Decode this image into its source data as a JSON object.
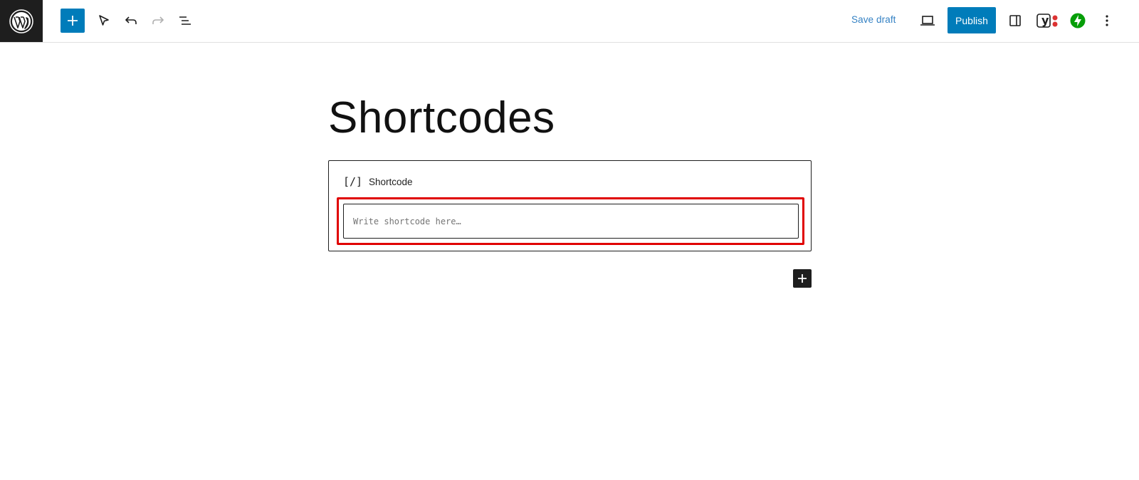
{
  "toolbar": {
    "logo_icon": "wordpress-logo-icon",
    "add_block_icon": "plus-icon",
    "tools_icon": "select-pointer-icon",
    "undo_icon": "undo-icon",
    "redo_icon": "redo-icon",
    "document_overview_icon": "list-view-icon",
    "save_draft_label": "Save draft",
    "preview_icon": "laptop-preview-icon",
    "publish_label": "Publish",
    "settings_icon": "sidebar-settings-icon",
    "yoast_icon": "yoast-seo-icon",
    "jetpack_icon": "jetpack-bolt-icon",
    "options_icon": "more-vertical-icon"
  },
  "colors": {
    "accent": "#007cba",
    "dark": "#1e1e1e",
    "highlight": "#e00000",
    "jetpack": "#069e08",
    "yoast_dot": "#dc3232"
  },
  "editor": {
    "post_title": "Shortcodes",
    "block": {
      "icon_glyph": "[/]",
      "label": "Shortcode",
      "input_placeholder": "Write shortcode here…",
      "input_value": ""
    },
    "inline_inserter_icon": "plus-icon"
  }
}
